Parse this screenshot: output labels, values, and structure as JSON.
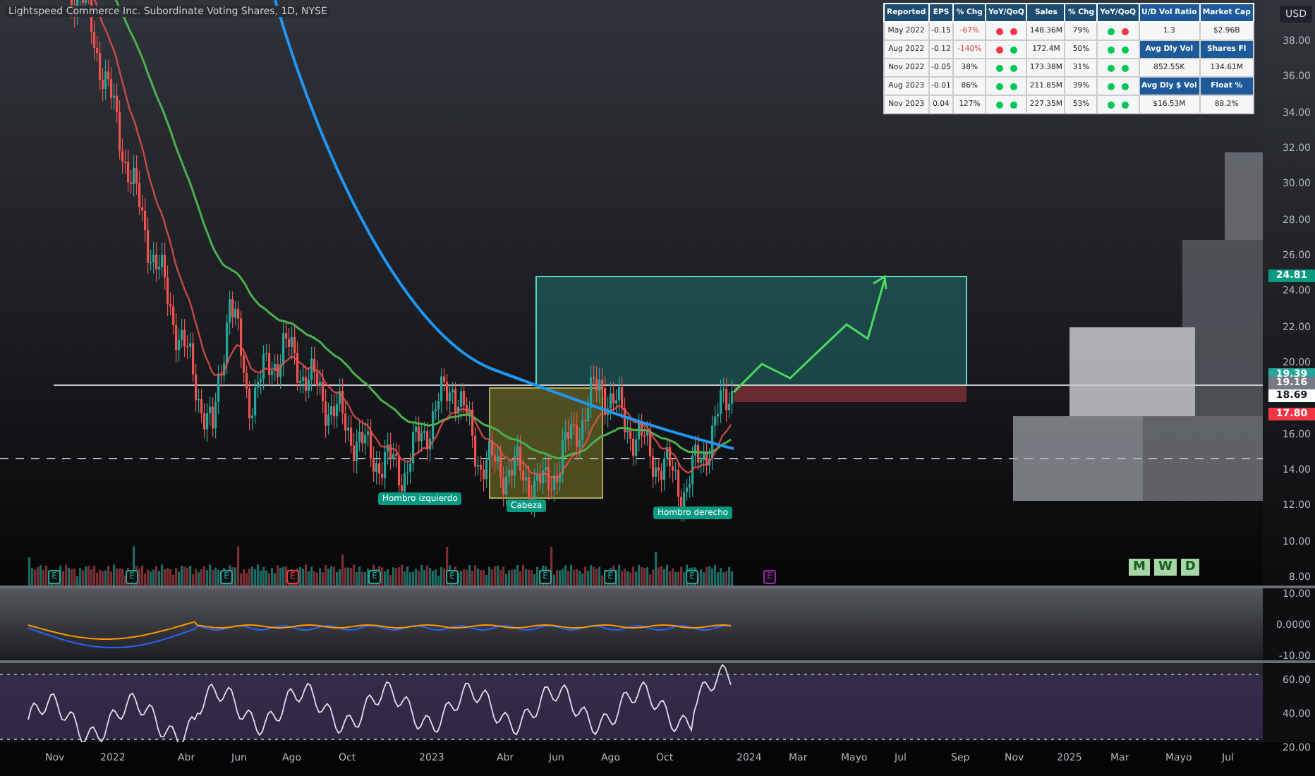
{
  "title": "Lightspeed Commerce Inc. Subordinate Voting Shares, 1D, NYSE",
  "currency": "USD",
  "fundamentals": {
    "columns": [
      "Reported",
      "EPS",
      "% Chg",
      "YoY/QoQ",
      "Sales",
      "% Chg",
      "YoY/QoQ"
    ],
    "rows": [
      {
        "reported": "May 2022",
        "eps": "-0.15",
        "eps_chg": "-67%",
        "eps_chg_negative": true,
        "eps_dots": [
          {
            "color": "#f23645"
          },
          {
            "color": "#f23645"
          }
        ],
        "sales": "148.36M",
        "sales_chg": "79%",
        "sales_dots": [
          {
            "color": "#00c853"
          },
          {
            "color": "#f23645"
          }
        ]
      },
      {
        "reported": "Aug 2022",
        "eps": "-0.12",
        "eps_chg": "-140%",
        "eps_chg_negative": true,
        "eps_dots": [
          {
            "color": "#f23645"
          },
          {
            "color": "#00c853"
          }
        ],
        "sales": "172.4M",
        "sales_chg": "50%",
        "sales_dots": [
          {
            "color": "#00c853"
          },
          {
            "color": "#00c853"
          }
        ]
      },
      {
        "reported": "Nov 2022",
        "eps": "-0.05",
        "eps_chg": "38%",
        "eps_chg_negative": false,
        "eps_dots": [
          {
            "color": "#00c853"
          },
          {
            "color": "#00c853"
          }
        ],
        "sales": "173.38M",
        "sales_chg": "31%",
        "sales_dots": [
          {
            "color": "#00c853"
          },
          {
            "color": "#00c853"
          }
        ]
      },
      {
        "reported": "Aug 2023",
        "eps": "-0.01",
        "eps_chg": "86%",
        "eps_chg_negative": false,
        "eps_dots": [
          {
            "color": "#00c853"
          },
          {
            "color": "#00c853"
          }
        ],
        "sales": "211.85M",
        "sales_chg": "39%",
        "sales_dots": [
          {
            "color": "#00c853"
          },
          {
            "color": "#00c853"
          }
        ]
      },
      {
        "reported": "Nov 2023",
        "eps": "0.04",
        "eps_chg": "127%",
        "eps_chg_negative": false,
        "eps_dots": [
          {
            "color": "#00c853"
          },
          {
            "color": "#00c853"
          }
        ],
        "sales": "227.35M",
        "sales_chg": "53%",
        "sales_dots": [
          {
            "color": "#00c853"
          },
          {
            "color": "#00c853"
          }
        ]
      }
    ],
    "stats": [
      {
        "kind": "header",
        "cells": [
          "U/D Vol Ratio",
          "Market Cap"
        ]
      },
      {
        "kind": "value",
        "cells": [
          "1.3",
          "$2.96B"
        ]
      },
      {
        "kind": "header",
        "cells": [
          "Avg Dly Vol",
          "Shares Fl"
        ]
      },
      {
        "kind": "value",
        "cells": [
          "852.55K",
          "134.61M"
        ]
      },
      {
        "kind": "header",
        "cells": [
          "Avg Dly $ Vol",
          "Float %"
        ]
      },
      {
        "kind": "value",
        "cells": [
          "$16.53M",
          "88.2%"
        ]
      }
    ]
  },
  "price_axis": {
    "ticks": [
      "38.00",
      "36.00",
      "34.00",
      "32.00",
      "30.00",
      "28.00",
      "26.00",
      "24.00",
      "22.00",
      "20.00",
      "16.00",
      "14.00",
      "12.00",
      "10.00",
      "8.00"
    ],
    "markers": [
      {
        "value": "24.81",
        "color": "#089981"
      },
      {
        "value": "19.39",
        "color": "#26a69a"
      },
      {
        "value": "19.16",
        "color": "#787b86"
      },
      {
        "value": "18.69",
        "color": "#ffffff"
      },
      {
        "value": "17.80",
        "color": "#f23645"
      }
    ]
  },
  "pattern_labels": [
    "Hombro izquierdo",
    "Cabeza",
    "Hombro derecho"
  ],
  "timeframes": [
    "M",
    "W",
    "D"
  ],
  "earnings_markers": [
    {
      "label": "E",
      "color": "#26a69a"
    },
    {
      "label": "E",
      "color": "#26a69a"
    },
    {
      "label": "E",
      "color": "#26a69a"
    },
    {
      "label": "E",
      "color": "#f23645"
    },
    {
      "label": "E",
      "color": "#26a69a"
    },
    {
      "label": "E",
      "color": "#26a69a"
    },
    {
      "label": "E",
      "color": "#26a69a"
    },
    {
      "label": "E",
      "color": "#26a69a"
    },
    {
      "label": "E",
      "color": "#26a69a"
    },
    {
      "label": "E",
      "color": "#9c27b0"
    }
  ],
  "macd_axis": [
    "10.00",
    "0.0000",
    "-10.00"
  ],
  "rsi_axis": [
    "60.00",
    "40.00",
    "20.00"
  ],
  "time_axis": [
    "Nov",
    "2022",
    "Abr",
    "Jun",
    "Ago",
    "Oct",
    "2023",
    "Abr",
    "Jun",
    "Ago",
    "Oct",
    "2024",
    "Mar",
    "Mayo",
    "Jul",
    "Sep",
    "Nov",
    "2025",
    "Mar",
    "Mayo",
    "Jul"
  ]
}
